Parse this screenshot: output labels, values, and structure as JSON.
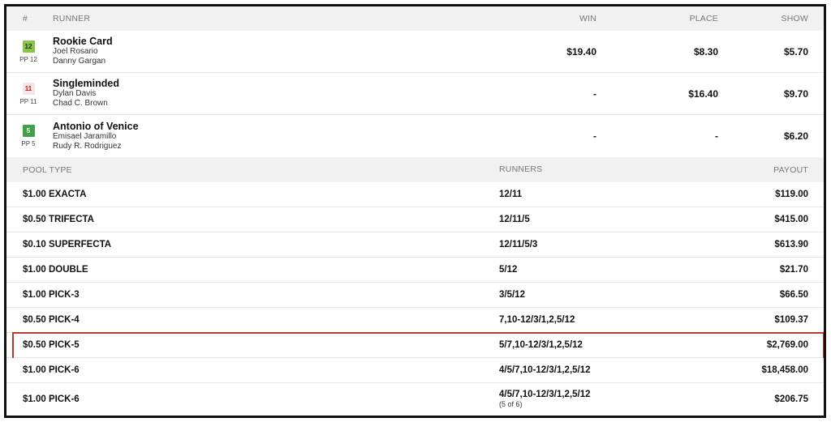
{
  "runners_header": {
    "num": "#",
    "runner": "RUNNER",
    "win": "WIN",
    "place": "PLACE",
    "show": "SHOW"
  },
  "runners": [
    {
      "pp": "12",
      "pp_label": "PP 12",
      "badge_bg": "#8bc34a",
      "badge_fg": "#1b3a0a",
      "name": "Rookie Card",
      "jockey": "Joel Rosario",
      "trainer": "Danny Gargan",
      "win": "$19.40",
      "place": "$8.30",
      "show": "$5.70"
    },
    {
      "pp": "11",
      "pp_label": "PP 11",
      "badge_bg": "#f5e6e6",
      "badge_fg": "#b71c1c",
      "name": "Singleminded",
      "jockey": "Dylan Davis",
      "trainer": "Chad C. Brown",
      "win": "-",
      "place": "$16.40",
      "show": "$9.70"
    },
    {
      "pp": "5",
      "pp_label": "PP 5",
      "badge_bg": "#43a047",
      "badge_fg": "#ffffff",
      "name": "Antonio of Venice",
      "jockey": "Emisael Jaramillo",
      "trainer": "Rudy R. Rodriguez",
      "win": "-",
      "place": "-",
      "show": "$6.20"
    }
  ],
  "pools_header": {
    "type": "POOL TYPE",
    "runners": "RUNNERS",
    "payout": "PAYOUT"
  },
  "pools": [
    {
      "type": "$1.00 EXACTA",
      "runners": "12/11",
      "note": "",
      "payout": "$119.00"
    },
    {
      "type": "$0.50 TRIFECTA",
      "runners": "12/11/5",
      "note": "",
      "payout": "$415.00"
    },
    {
      "type": "$0.10 SUPERFECTA",
      "runners": "12/11/5/3",
      "note": "",
      "payout": "$613.90"
    },
    {
      "type": "$1.00 DOUBLE",
      "runners": "5/12",
      "note": "",
      "payout": "$21.70"
    },
    {
      "type": "$1.00 PICK-3",
      "runners": "3/5/12",
      "note": "",
      "payout": "$66.50"
    },
    {
      "type": "$0.50 PICK-4",
      "runners": "7,10-12/3/1,2,5/12",
      "note": "",
      "payout": "$109.37"
    },
    {
      "type": "$0.50 PICK-5",
      "runners": "5/7,10-12/3/1,2,5/12",
      "note": "",
      "payout": "$2,769.00"
    },
    {
      "type": "$1.00 PICK-6",
      "runners": "4/5/7,10-12/3/1,2,5/12",
      "note": "",
      "payout": "$18,458.00"
    },
    {
      "type": "$1.00 PICK-6",
      "runners": "4/5/7,10-12/3/1,2,5/12",
      "note": "(5 of 6)",
      "payout": "$206.75"
    }
  ],
  "highlight_color": "#c0392b"
}
